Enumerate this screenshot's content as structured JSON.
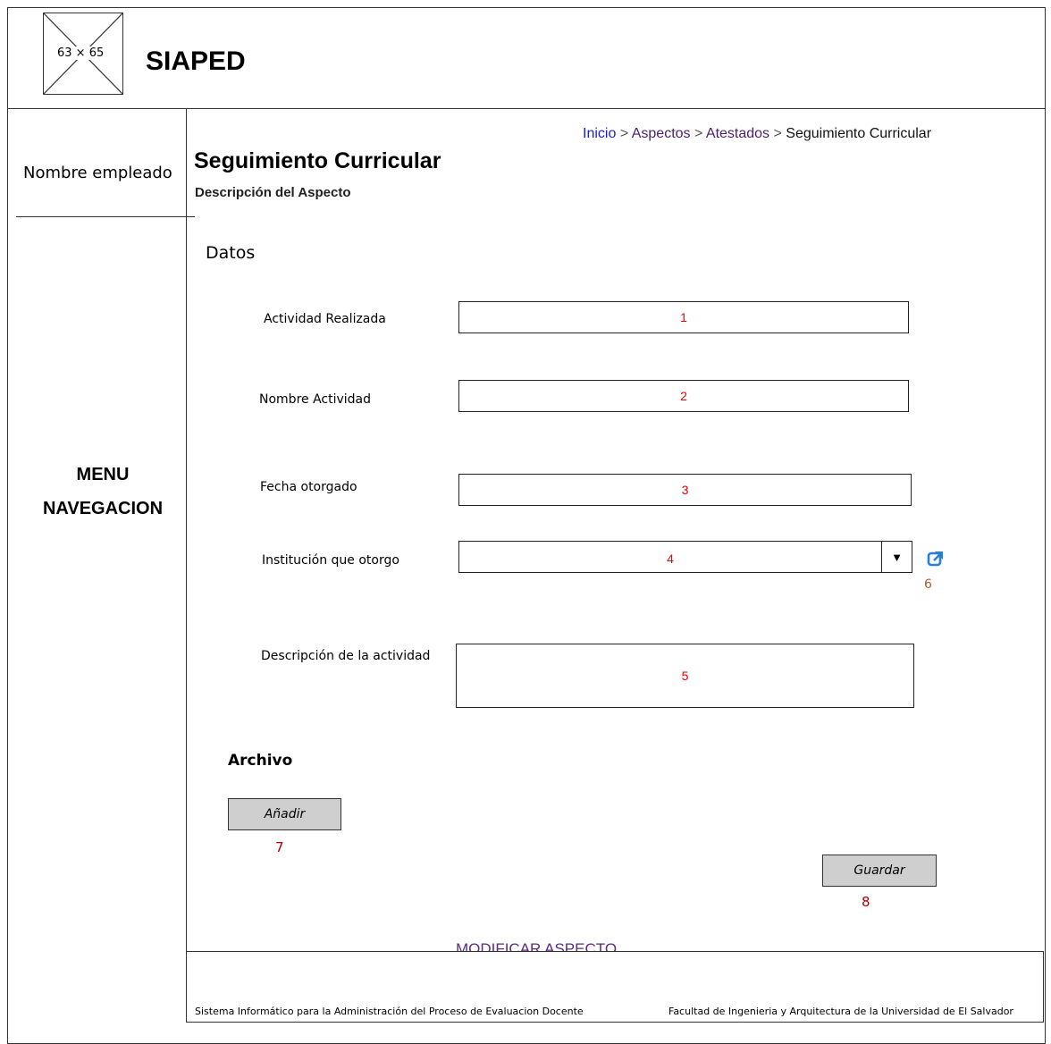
{
  "header": {
    "logo_placeholder": "63 × 65",
    "app_title": "SIAPED"
  },
  "sidebar": {
    "employee_name": "Nombre empleado",
    "menu_line1": "MENU",
    "menu_line2": "NAVEGACION"
  },
  "breadcrumb": {
    "items": [
      "Inicio",
      "Aspectos",
      "Atestados",
      "Seguimiento Curricular"
    ],
    "separator": ">"
  },
  "page": {
    "title": "Seguimiento Curricular",
    "subtitle": "Descripción del Aspecto",
    "section_title": "Datos"
  },
  "form": {
    "fields": [
      {
        "label": "Actividad Realizada",
        "marker": "1"
      },
      {
        "label": "Nombre Actividad",
        "marker": "2"
      },
      {
        "label": "Fecha otorgado",
        "marker": "3"
      },
      {
        "label": "Institución que otorgo",
        "marker": "4"
      },
      {
        "label": "Descripción de la actividad",
        "marker": "5"
      }
    ],
    "dropdown_arrow": "▼",
    "external_link_marker": "6"
  },
  "archivo": {
    "title": "Archivo",
    "add_button": "Añadir",
    "add_marker": "7"
  },
  "actions": {
    "save_button": "Guardar",
    "save_marker": "8"
  },
  "screen_name": "MODIFICAR ASPECTO",
  "footer": {
    "left": "Sistema Informático para la Administración del Proceso de Evaluacion Docente",
    "right": "Facultad de Ingenieria y Arquitectura de la Universidad de El Salvador"
  },
  "colors": {
    "breadcrumb_link": "#1f1fd0",
    "breadcrumb_visited": "#4b1f6b",
    "field_marker": "#e00000",
    "button_bg": "#cfcfcf",
    "external_icon": "#2a7fd4"
  }
}
